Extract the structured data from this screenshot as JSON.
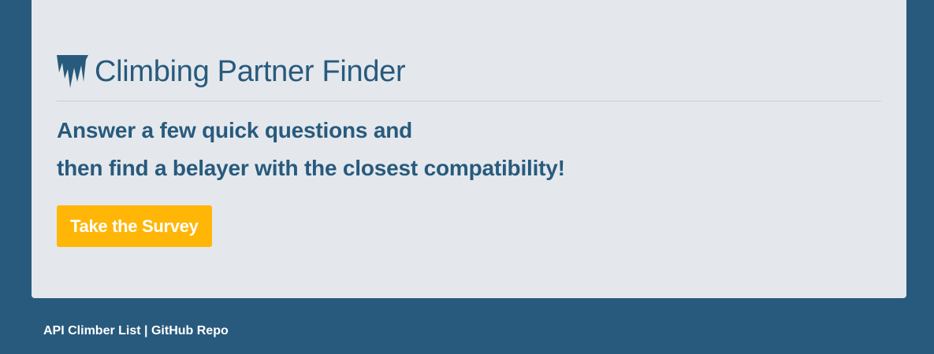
{
  "header": {
    "title": "Climbing Partner Finder",
    "icon": "icicles-icon"
  },
  "lead": {
    "line1": "Answer a few quick questions and",
    "line2": "then find a belayer with the closest compatibility!"
  },
  "cta": {
    "label": "Take the Survey"
  },
  "footer": {
    "link1": "API Climber List",
    "separator": "|",
    "link2": "GitHub Repo"
  },
  "colors": {
    "page_background": "#285a7d",
    "panel_background": "#e4e8ec",
    "brand_text": "#285a7d",
    "button": "#ffb606"
  }
}
